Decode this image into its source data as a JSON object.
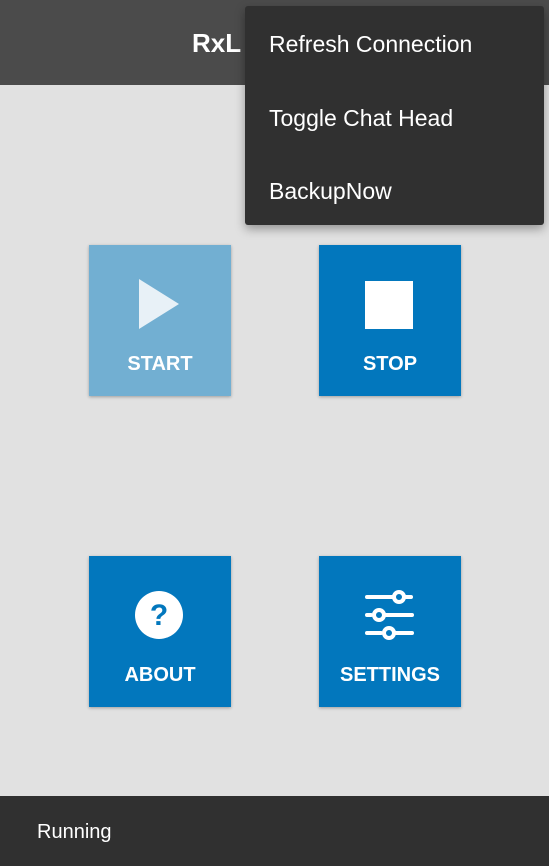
{
  "app": {
    "title": "RxL"
  },
  "menu": {
    "items": [
      "Refresh Connection",
      "Toggle Chat Head",
      "BackupNow"
    ]
  },
  "tiles": {
    "start": "START",
    "stop": "STOP",
    "about": "ABOUT",
    "settings": "SETTINGS"
  },
  "status": {
    "text": "Running"
  }
}
